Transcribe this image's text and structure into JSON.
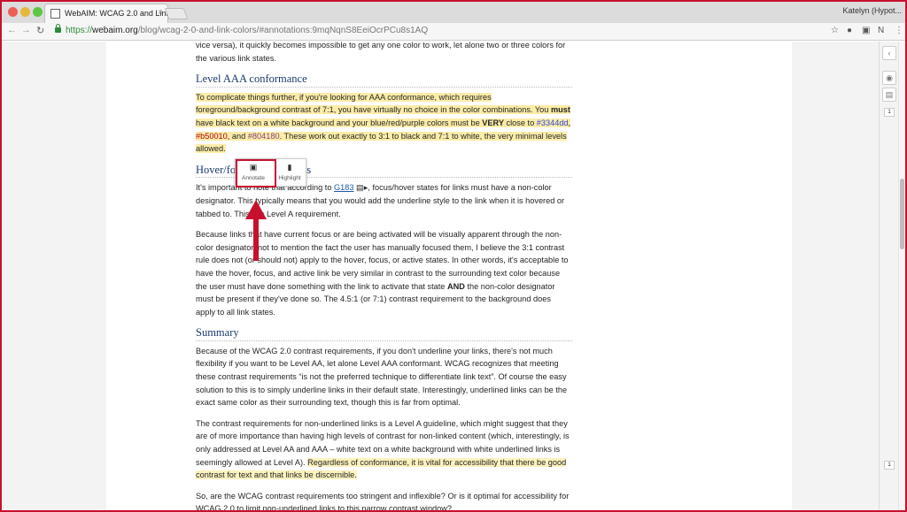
{
  "browser": {
    "tab_title": "WebAIM: WCAG 2.0 and Link C",
    "profile_name": "Katelyn (Hypot...",
    "url_scheme": "https://",
    "url_host": "webaim.org",
    "url_path": "/blog/wcag-2-0-and-link-colors/#annotations:9mqNqnS8EeiOcrPCu8s1AQ"
  },
  "article": {
    "intro_text": "vice versa), it quickly becomes impossible to get any one color to work, let alone two or three colors for the various link states.",
    "sec1_heading": "Level AAA conformance",
    "sec1_p1_a": "To complicate things further, if you're looking for AAA conformance, which requires foreground/background contrast of 7:1, you have virtually no choice in the color combinations. You ",
    "sec1_p1_must": "must",
    "sec1_p1_b": " have black text on a white background and your blue/red/purple colors must be ",
    "sec1_p1_very": "VERY",
    "sec1_p1_c": " close to ",
    "color_blue": "#3344dd",
    "sep1": ", ",
    "color_red": "#b50010",
    "sep2": ", and ",
    "color_purple": "#804180",
    "sec1_p1_d": ". These work out exactly to 3:1 to black and 7:1 to white, the very minimal levels allowed.",
    "sec2_heading": "Hover/focus requirements",
    "sec2_p1_a": "It's important to note that according to ",
    "sec2_p1_link": "G183",
    "sec2_p1_b": ", focus/hover states for links must have a non-color designator. This typically means that you would add the underline style to the link when it is hovered or tabbed to. This is a Level A requirement.",
    "sec2_p2_a": "Because links that have current focus or are being activated will be visually apparent through the non-color designator, not to mention the fact the user has manually focused them, I believe the 3:1 contrast rule does not (or should not) apply to the hover, focus, or active states. In other words, it's acceptable to have the hover, focus, and active link be very similar in contrast to the surrounding text color because the user must have done something with the link to activate that state ",
    "sec2_p2_and": "AND",
    "sec2_p2_b": " the non-color designator must be present if they've done so. The 4.5:1 (or 7:1) contrast requirement to the background does apply to all link states.",
    "sec3_heading": "Summary",
    "sec3_p1": "Because of the WCAG 2.0 contrast requirements, if you don't underline your links, there's not much flexibility if you want to be Level AA, let alone Level AAA conformant. WCAG recognizes that meeting these contrast requirements “is not the preferred technique to differentiate link text”. Of course the easy solution to this is to simply underline links in their default state. Interestingly, underlined links can be the exact same color as their surrounding text, though this is far from optimal.",
    "sec3_p2_a": "The contrast requirements for non-underlined links is a Level A guideline, which might suggest that they are of more importance than having high levels of contrast for non-linked content (which, interestingly, is only addressed at Level AA and AAA – white text on a white background with white underlined links is seemingly allowed at Level A). ",
    "sec3_p2_hl": "Regardless of conformance, it is vital for accessibility that there be good contrast for text and that links be discernible.",
    "sec3_p3": "So, are the WCAG contrast requirements too stringent and inflexible? Or is it optimal for accessibility for WCAG 2.0 to limit non-underlined links to this narrow contrast window?"
  },
  "popup": {
    "annotate_label": "Annotate",
    "highlight_label": "Highlight"
  },
  "sidebar": {
    "count_top": "1",
    "count_bottom": "1"
  }
}
